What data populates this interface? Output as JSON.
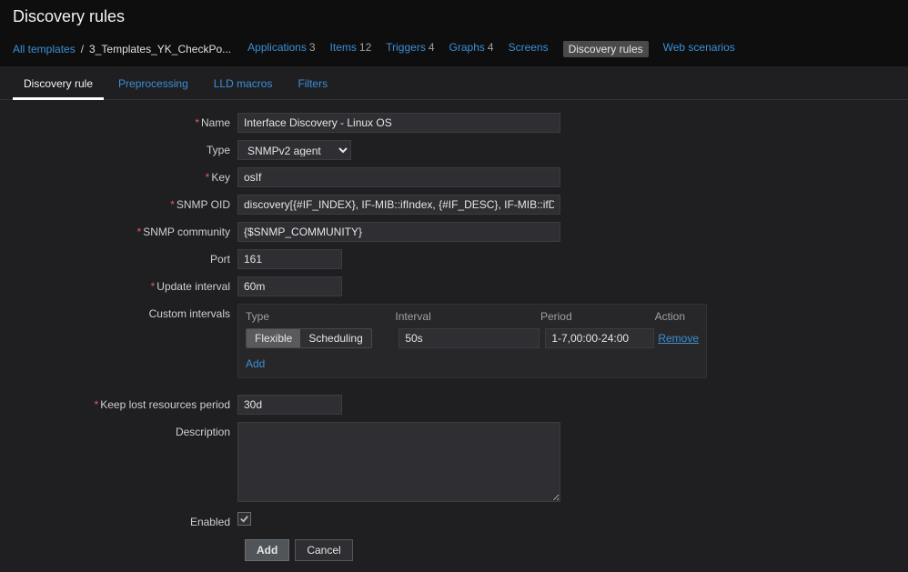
{
  "page_title": "Discovery rules",
  "breadcrumb": {
    "all_templates": "All templates",
    "current": "3_Templates_YK_CheckPo..."
  },
  "nav": [
    {
      "label": "Applications",
      "count": "3"
    },
    {
      "label": "Items",
      "count": "12"
    },
    {
      "label": "Triggers",
      "count": "4"
    },
    {
      "label": "Graphs",
      "count": "4"
    },
    {
      "label": "Screens",
      "count": ""
    },
    {
      "label": "Discovery rules",
      "count": "",
      "active": true
    },
    {
      "label": "Web scenarios",
      "count": ""
    }
  ],
  "tabs": {
    "discovery_rule": "Discovery rule",
    "preprocessing": "Preprocessing",
    "lld_macros": "LLD macros",
    "filters": "Filters"
  },
  "labels": {
    "name": "Name",
    "type": "Type",
    "key": "Key",
    "snmp_oid": "SNMP OID",
    "snmp_community": "SNMP community",
    "port": "Port",
    "update_interval": "Update interval",
    "custom_intervals": "Custom intervals",
    "keep_lost": "Keep lost resources period",
    "description": "Description",
    "enabled": "Enabled"
  },
  "values": {
    "name": "Interface Discovery - Linux OS",
    "type": "SNMPv2 agent",
    "key": "osIf",
    "snmp_oid": "discovery[{#IF_INDEX}, IF-MIB::ifIndex, {#IF_DESC}, IF-MIB::ifDescr]",
    "snmp_community": "{$SNMP_COMMUNITY}",
    "port": "161",
    "update_interval": "60m",
    "keep_lost": "30d",
    "description": "",
    "enabled": true
  },
  "custom_intervals": {
    "head_type": "Type",
    "head_interval": "Interval",
    "head_period": "Period",
    "head_action": "Action",
    "flexible": "Flexible",
    "scheduling": "Scheduling",
    "interval": "50s",
    "period": "1-7,00:00-24:00",
    "remove": "Remove",
    "add": "Add"
  },
  "buttons": {
    "add": "Add",
    "cancel": "Cancel"
  }
}
